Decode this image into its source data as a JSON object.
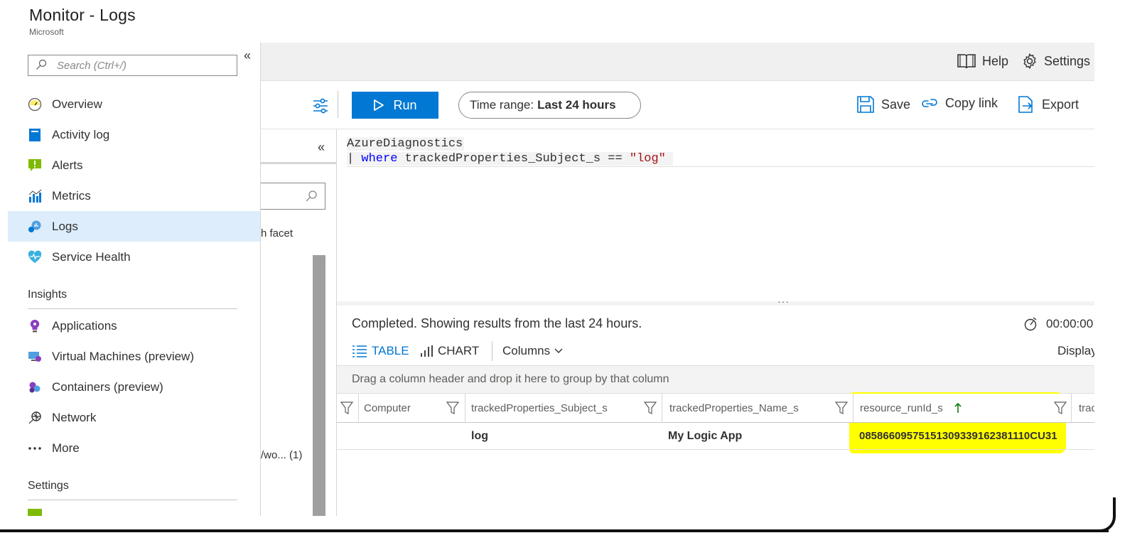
{
  "window": {
    "title": "Monitor - Logs",
    "subtitle": "Microsoft"
  },
  "sidebar": {
    "search_placeholder": "Search (Ctrl+/)",
    "collapse_glyph": "«",
    "items": [
      {
        "label": "Overview",
        "icon": "overview-icon"
      },
      {
        "label": "Activity log",
        "icon": "activity-log-icon"
      },
      {
        "label": "Alerts",
        "icon": "alerts-icon"
      },
      {
        "label": "Metrics",
        "icon": "metrics-icon"
      },
      {
        "label": "Logs",
        "icon": "logs-icon",
        "selected": true
      },
      {
        "label": "Service Health",
        "icon": "service-health-icon"
      }
    ],
    "insights_heading": "Insights",
    "insights_items": [
      {
        "label": "Applications",
        "icon": "applications-icon"
      },
      {
        "label": "Virtual Machines (preview)",
        "icon": "virtual-machines-icon"
      },
      {
        "label": "Containers (preview)",
        "icon": "containers-icon"
      },
      {
        "label": "Network",
        "icon": "network-icon"
      },
      {
        "label": "More",
        "icon": "more-icon"
      }
    ],
    "settings_heading": "Settings"
  },
  "topbar": {
    "help_label": "Help",
    "settings_label": "Settings"
  },
  "toolbar": {
    "run_label": "Run",
    "time_range_prefix": "Time range:",
    "time_range_value": "Last 24 hours",
    "save_label": "Save",
    "copy_link_label": "Copy link",
    "export_label": "Export"
  },
  "schema_pane": {
    "collapse_glyph": "«",
    "facet_text": "h facet",
    "item_text": "/wo...  (1)"
  },
  "query": {
    "line1": "AzureDiagnostics",
    "line2_pipe": "| ",
    "line2_keyword": "where",
    "line2_field": " trackedProperties_Subject_s == ",
    "line2_string": "\"log\""
  },
  "results": {
    "status": "Completed. Showing results from the last 24 hours.",
    "timer": "00:00:00",
    "tab_table": "TABLE",
    "tab_chart": "CHART",
    "columns_label": "Columns",
    "display_label": "Display",
    "group_hint": "Drag a column header and drop it here to group by that column",
    "columns": [
      {
        "label": "Computer"
      },
      {
        "label": "trackedProperties_Subject_s"
      },
      {
        "label": "trackedProperties_Name_s"
      },
      {
        "label": "resource_runId_s",
        "sorted": "ascending"
      },
      {
        "label": "trac"
      }
    ],
    "rows": [
      {
        "computer": "",
        "subject": "log",
        "name": "My Logic App",
        "run_id": "08586609575151309339162381110CU31"
      }
    ]
  },
  "colors": {
    "accent": "#0078d4",
    "selected_nav": "#ddedfb",
    "highlight": "#ffff00",
    "sort_arrow": "#107c10"
  }
}
